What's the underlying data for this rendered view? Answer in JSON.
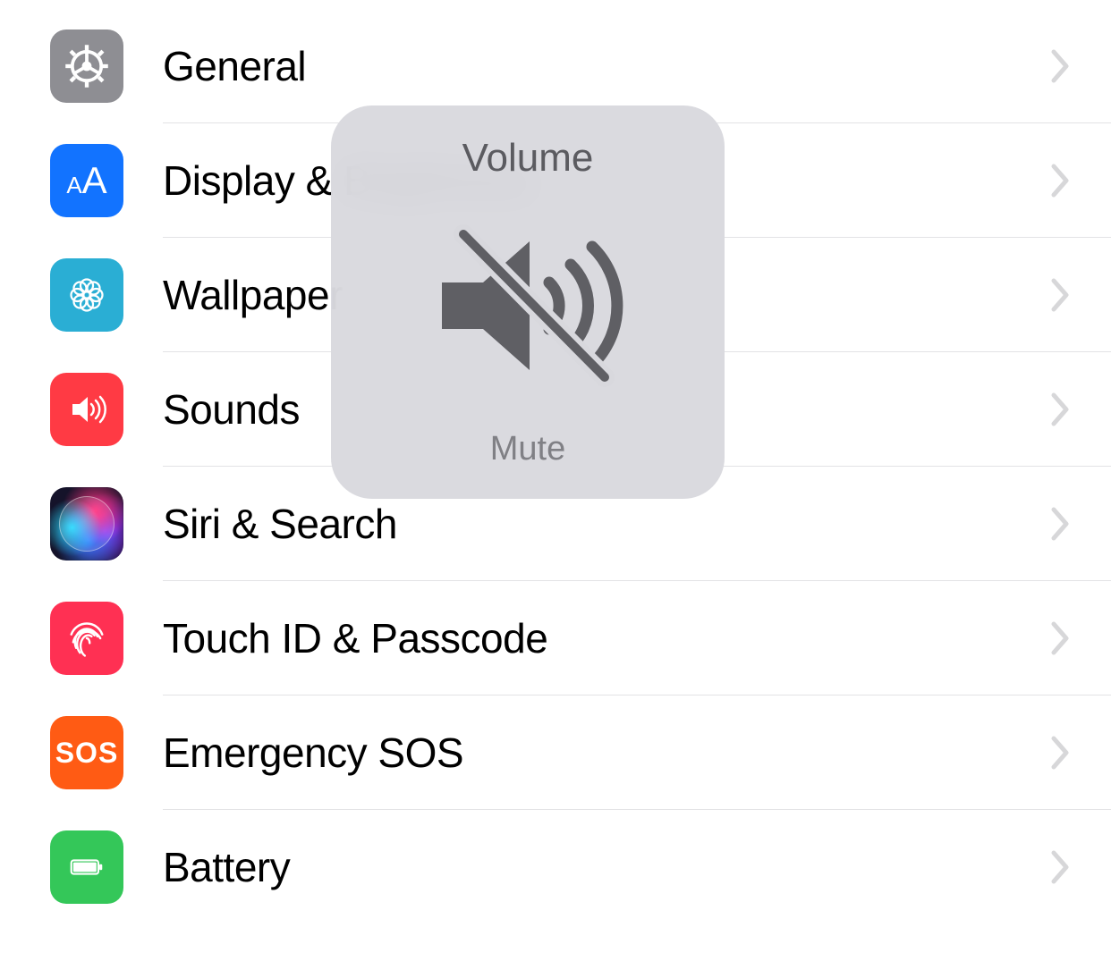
{
  "settings": {
    "items": [
      {
        "label": "General",
        "icon_name": "gear-icon",
        "bg": "bg-general"
      },
      {
        "label": "Display & Brightness",
        "icon_name": "text-size-icon",
        "bg": "bg-display"
      },
      {
        "label": "Wallpaper",
        "icon_name": "flower-icon",
        "bg": "bg-wallpaper"
      },
      {
        "label": "Sounds",
        "icon_name": "speaker-icon",
        "bg": "bg-sounds"
      },
      {
        "label": "Siri & Search",
        "icon_name": "siri-icon",
        "bg": "bg-siri"
      },
      {
        "label": "Touch ID & Passcode",
        "icon_name": "fingerprint-icon",
        "bg": "bg-touchid"
      },
      {
        "label": "Emergency SOS",
        "icon_name": "sos-icon",
        "bg": "bg-sos"
      },
      {
        "label": "Battery",
        "icon_name": "battery-icon",
        "bg": "bg-battery"
      }
    ]
  },
  "volume_hud": {
    "title": "Volume",
    "status": "Mute",
    "icon_name": "speaker-muted-icon"
  }
}
